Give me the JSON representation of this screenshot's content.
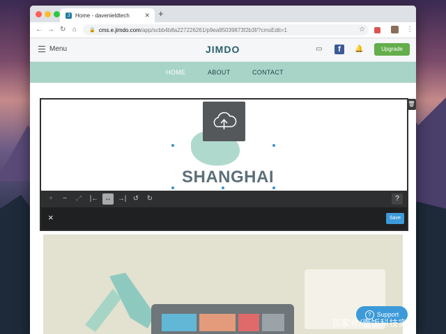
{
  "browser": {
    "tab_title": "Home - davenieldtech",
    "tab_favicon_letter": "J",
    "new_tab": "+",
    "url_host": "cms.e.jimdo.com",
    "url_path": "/app/scbb4b8a227226261/p9ea95039873f2b3f/?cmsEdit=1"
  },
  "jimdo_bar": {
    "menu_label": "Menu",
    "logo": "JIMDO",
    "upgrade_label": "Upgrade",
    "facebook_letter": "f"
  },
  "nav": {
    "items": [
      "HOME",
      "ABOUT",
      "CONTACT"
    ],
    "active": "HOME"
  },
  "editor": {
    "image_text": "SHANGHAI",
    "help_label": "?",
    "save_label": "Save",
    "close_label": "×"
  },
  "support": {
    "label": "Support",
    "icon": "?"
  },
  "watermark": "百家号/壹饭科技实录",
  "colors": {
    "nav_bg": "#a8d4c8",
    "upgrade_green": "#63ad4b",
    "save_blue": "#3c9ad8",
    "logo_teal": "#2a5e6c"
  }
}
